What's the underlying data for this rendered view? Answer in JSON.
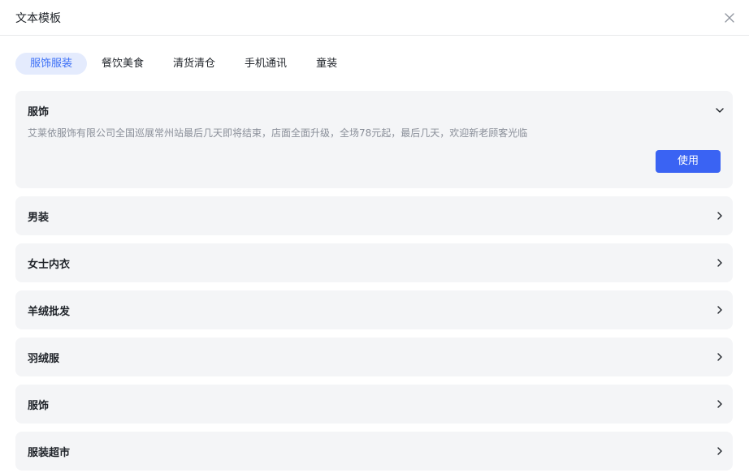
{
  "dialog": {
    "title": "文本模板"
  },
  "tabs": [
    {
      "label": "服饰服装",
      "active": true
    },
    {
      "label": "餐饮美食",
      "active": false
    },
    {
      "label": "清货清仓",
      "active": false
    },
    {
      "label": "手机通讯",
      "active": false
    },
    {
      "label": "童装",
      "active": false
    }
  ],
  "expanded": {
    "title": "服饰",
    "text": "艾莱依服饰有限公司全国巡展常州站最后几天即将结束，店面全面升级，全场78元起，最后几天，欢迎新老顾客光临",
    "use_label": "使用"
  },
  "categories": [
    {
      "title": "男装"
    },
    {
      "title": "女士内衣"
    },
    {
      "title": "羊绒批发"
    },
    {
      "title": "羽绒服"
    },
    {
      "title": "服饰"
    },
    {
      "title": "服装超市"
    }
  ],
  "colors": {
    "accent": "#3a63f3",
    "tab_active_bg": "#e4ebfd",
    "panel_bg": "#f4f5f7"
  },
  "icons": {
    "close": "close-icon",
    "expand": "chevron-down-icon",
    "collapse": "chevron-right-icon"
  }
}
